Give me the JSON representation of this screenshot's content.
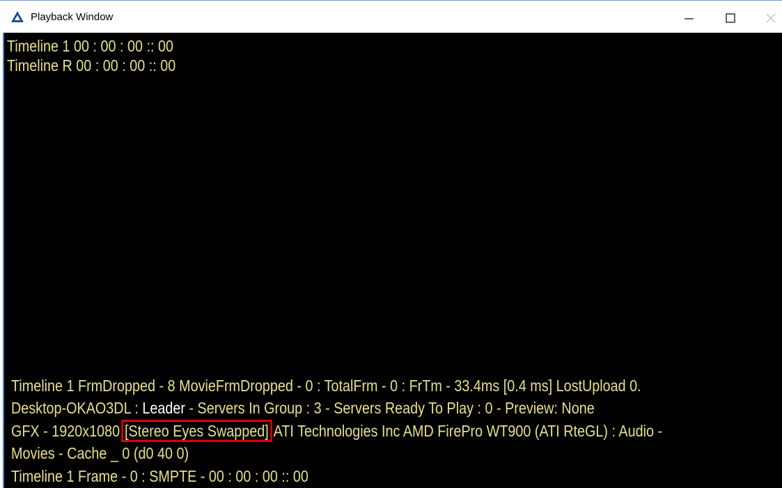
{
  "window": {
    "title": "Playback Window",
    "icon": "app-triangle-icon",
    "controls": {
      "minimize": "minimize-icon",
      "maximize": "maximize-icon",
      "close": "close-icon"
    }
  },
  "viewport": {
    "timeline_lines": [
      "Timeline 1 00 : 00 : 00 :: 00",
      "Timeline R 00 : 00 : 00 :: 00"
    ],
    "stats": {
      "line1": "Timeline 1  FrmDropped - 8 MovieFrmDropped - 0 : TotalFrm - 0 : FrTm - 33.4ms [0.4 ms] LostUpload 0.",
      "line2_host": "Desktop-OKAO3DL : ",
      "line2_role": "Leader",
      "line2_rest": " - Servers In Group : 3 - Servers Ready To Play : 0 - Preview: None",
      "line3_prefix": "GFX - 1920x1080",
      "line3_highlight": "[Stereo Eyes Swapped]",
      "line3_suffix": "ATI Technologies Inc AMD FirePro WT900 (ATI RteGL) : Audio -",
      "line4": "Movies - Cache _ 0 (d0 40 0)",
      "line5": "Timeline 1 Frame - 0 : SMPTE - 00 : 00 : 00 :: 00"
    },
    "colors": {
      "background": "#000000",
      "text": "#e6e08a",
      "highlight_border": "#e00000"
    }
  }
}
